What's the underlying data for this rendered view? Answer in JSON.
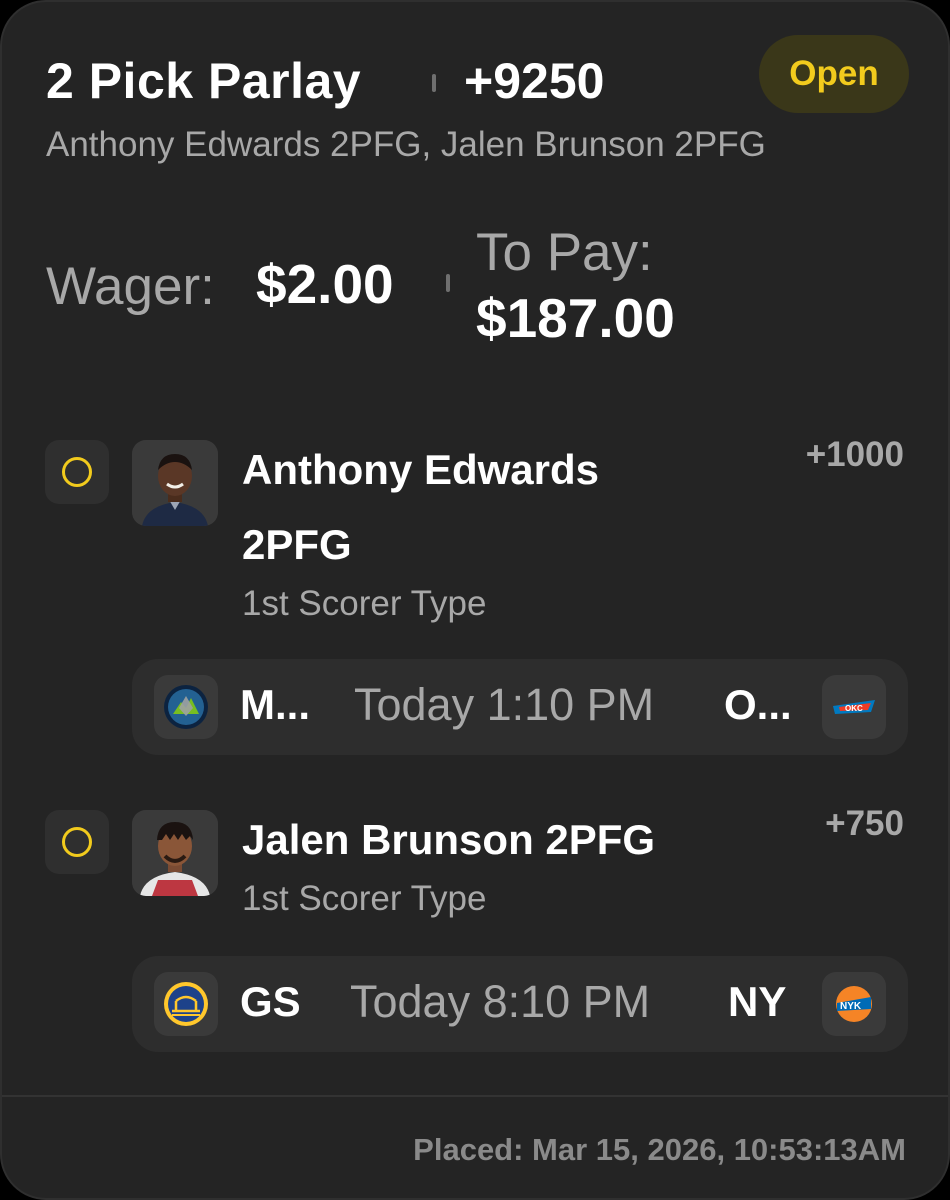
{
  "bet": {
    "title": "2 Pick Parlay",
    "odds": "+9250",
    "status": "Open",
    "summary": "Anthony Edwards 2PFG, Jalen Brunson 2PFG",
    "wager_label": "Wager:",
    "wager_value": "$2.00",
    "topay_label": "To Pay:",
    "topay_value": "$187.00",
    "placed": "Placed: Mar 15, 2026, 10:53:13AM"
  },
  "picks": [
    {
      "player": "Anthony Edwards 2PFG",
      "market": "1st Scorer Type",
      "odds": "+1000",
      "game": {
        "away_team": "M...",
        "time": "Today 1:10 PM",
        "home_team": "O...",
        "away_logo_icon": "timberwolves-logo-icon",
        "home_logo_icon": "thunder-logo-icon"
      }
    },
    {
      "player": "Jalen Brunson 2PFG",
      "market": "1st Scorer Type",
      "odds": "+750",
      "game": {
        "away_team": "GS",
        "time": "Today 8:10 PM",
        "home_team": "NY",
        "away_logo_icon": "warriors-logo-icon",
        "home_logo_icon": "knicks-logo-icon"
      }
    }
  ],
  "colors": {
    "accent_yellow": "#f2cb1d",
    "card_bg": "#242424",
    "muted_text": "#a8a8a8"
  }
}
